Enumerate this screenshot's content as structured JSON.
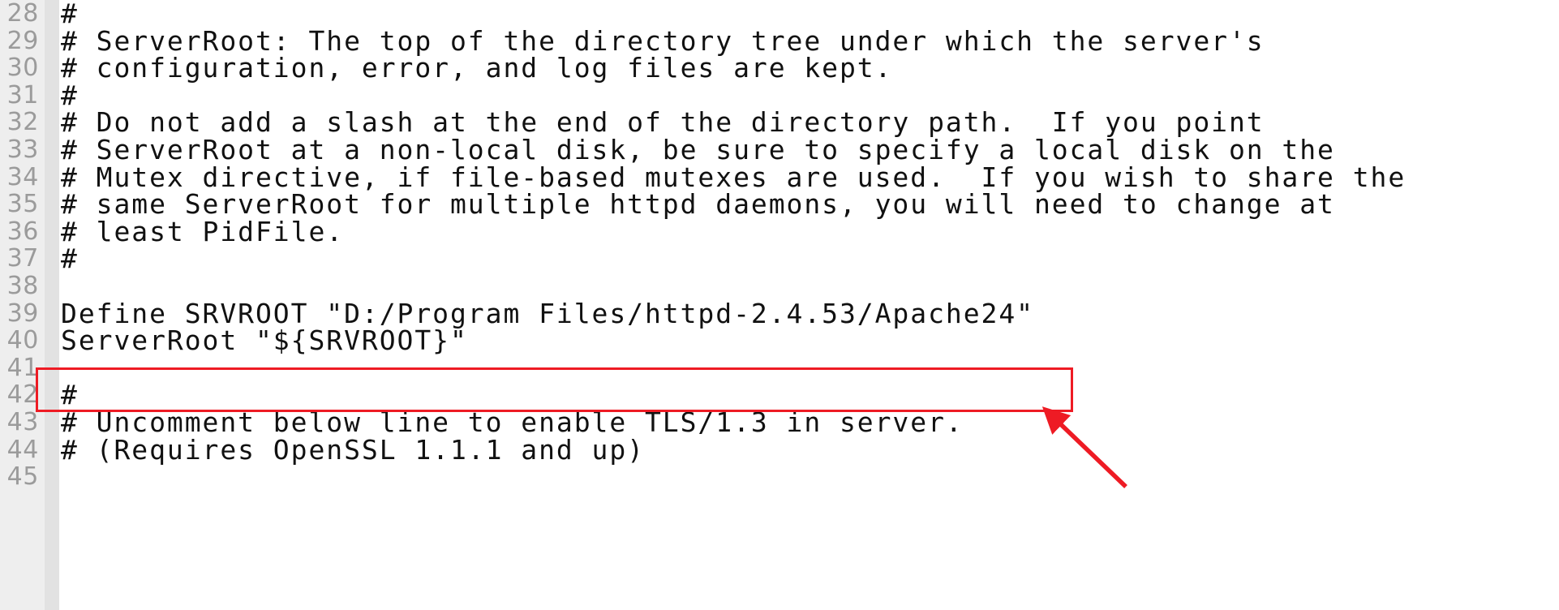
{
  "document": {
    "kind": "apache-httpd-conf-file",
    "first_visible_line": 28,
    "last_visible_line": 45,
    "colors": {
      "background": "#ffffff",
      "gutter": "#eeeeee",
      "gutter_edge": "#e2e2e2",
      "line_number_text": "#9b9b9b",
      "code_text": "#111111",
      "annotation": "#ee1b24"
    }
  },
  "lines": [
    {
      "number": "28",
      "text": "#"
    },
    {
      "number": "29",
      "text": "# ServerRoot: The top of the directory tree under which the server's"
    },
    {
      "number": "30",
      "text": "# configuration, error, and log files are kept."
    },
    {
      "number": "31",
      "text": "#"
    },
    {
      "number": "32",
      "text": "# Do not add a slash at the end of the directory path.  If you point"
    },
    {
      "number": "33",
      "text": "# ServerRoot at a non-local disk, be sure to specify a local disk on the"
    },
    {
      "number": "34",
      "text": "# Mutex directive, if file-based mutexes are used.  If you wish to share the"
    },
    {
      "number": "35",
      "text": "# same ServerRoot for multiple httpd daemons, you will need to change at"
    },
    {
      "number": "36",
      "text": "# least PidFile."
    },
    {
      "number": "37",
      "text": "#"
    },
    {
      "number": "38",
      "text": ""
    },
    {
      "number": "39",
      "text": "Define SRVROOT \"D:/Program Files/httpd-2.4.53/Apache24\""
    },
    {
      "number": "40",
      "text": "ServerRoot \"${SRVROOT}\""
    },
    {
      "number": "41",
      "text": ""
    },
    {
      "number": "42",
      "text": "#"
    },
    {
      "number": "43",
      "text": "# Uncomment below line to enable TLS/1.3 in server."
    },
    {
      "number": "44",
      "text": "# (Requires OpenSSL 1.1.1 and up)"
    },
    {
      "number": "45",
      "text": ""
    }
  ],
  "annotations": {
    "highlight_box": {
      "target_line": "39",
      "target_text": "Define SRVROOT \"D:/Program Files/httpd-2.4.53/Apache24\"",
      "color": "#ee1b24"
    },
    "arrow": {
      "points_to": "highlight-box-bottom-right",
      "color": "#ee1b24"
    }
  }
}
